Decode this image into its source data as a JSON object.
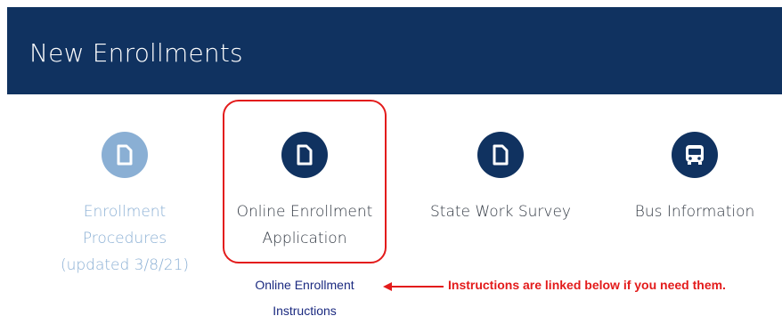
{
  "header": {
    "title": "New Enrollments",
    "background_color": "#103260"
  },
  "tiles": [
    {
      "label": "Enrollment Procedures (updated 3/8/21)",
      "icon": "document-icon",
      "color": "#8aafd4"
    },
    {
      "label": "Online Enrollment Application",
      "icon": "document-icon",
      "color": "#103260",
      "highlighted": true
    },
    {
      "label": "State Work Survey",
      "icon": "document-icon",
      "color": "#103260"
    },
    {
      "label": "Bus Information",
      "icon": "bus-icon",
      "color": "#103260"
    }
  ],
  "instructions_link": {
    "label": "Online Enrollment Instructions",
    "color": "#1b2a80"
  },
  "annotation": {
    "text": "Instructions are linked below if you need them.",
    "color": "#e31b1b",
    "arrow_icon": "left-arrow-icon"
  }
}
